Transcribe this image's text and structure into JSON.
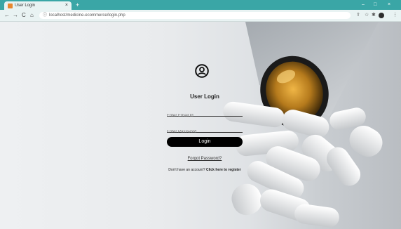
{
  "browser": {
    "tab_title": "User Login",
    "tab_close": "×",
    "new_tab": "+",
    "url": "localhost/medicine-ecommerce/login.php",
    "controls": {
      "minimize": "–",
      "maximize": "□",
      "close": "×"
    },
    "nav": {
      "back": "←",
      "forward": "→",
      "reload": "C",
      "home": "⌂"
    },
    "toolbar_icons": [
      "share-icon",
      "star-icon",
      "extensions-icon",
      "profile-avatar",
      "menu-icon"
    ],
    "accent_color": "#3aa6a6"
  },
  "login": {
    "title": "User Login",
    "email_placeholder": "Enter Email Id",
    "password_placeholder": "Enter Password",
    "button_label": "Login",
    "forgot_link": "Forgot Password?",
    "register_prompt": "Don't have an account?",
    "register_link": "Click here to register"
  }
}
